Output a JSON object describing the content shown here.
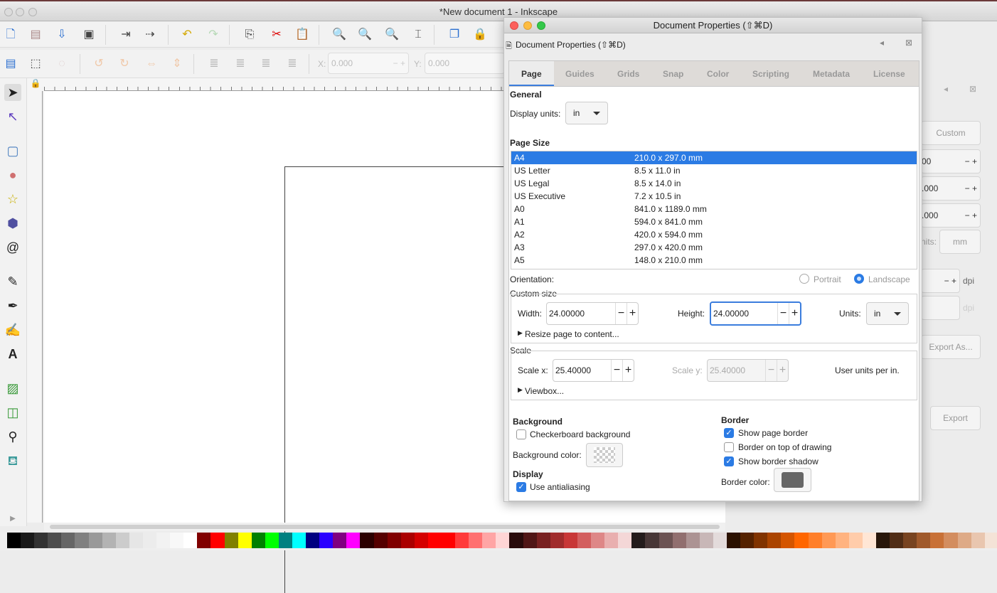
{
  "window": {
    "title": "*New document 1 - Inkscape"
  },
  "toolbar": {
    "x_label": "X:",
    "x_value": "0.000",
    "y_label": "Y:",
    "y_value": "0.000"
  },
  "dock": {
    "custom": "Custom",
    "v1": "00",
    "v2": ".000",
    "v3": ".000",
    "units_label": "nits:",
    "units": "mm",
    "dpi1": "dpi",
    "dpi2": "dpi",
    "export_as": "Export As...",
    "export": "Export"
  },
  "dialog": {
    "window_title": "Document Properties (⇧⌘D)",
    "panel_title": "Document Properties (⇧⌘D)",
    "tabs": [
      "Page",
      "Guides",
      "Grids",
      "Snap",
      "Color",
      "Scripting",
      "Metadata",
      "License"
    ],
    "general": {
      "heading": "General",
      "display_units_label": "Display units:",
      "display_units": "in"
    },
    "page_size": {
      "heading": "Page Size",
      "rows": [
        {
          "name": "A4",
          "size": "210.0 x 297.0 mm",
          "selected": true
        },
        {
          "name": "US Letter",
          "size": "8.5 x 11.0 in"
        },
        {
          "name": "US Legal",
          "size": "8.5 x 14.0 in"
        },
        {
          "name": "US Executive",
          "size": "7.2 x 10.5 in"
        },
        {
          "name": "A0",
          "size": "841.0 x 1189.0 mm"
        },
        {
          "name": "A1",
          "size": "594.0 x 841.0 mm"
        },
        {
          "name": "A2",
          "size": "420.0 x 594.0 mm"
        },
        {
          "name": "A3",
          "size": "297.0 x 420.0 mm"
        },
        {
          "name": "A5",
          "size": "148.0 x 210.0 mm"
        }
      ]
    },
    "orientation": {
      "label": "Orientation:",
      "portrait": "Portrait",
      "landscape": "Landscape",
      "selected": "Landscape"
    },
    "custom_size": {
      "heading": "Custom size",
      "width_label": "Width:",
      "width": "24.00000",
      "height_label": "Height:",
      "height": "24.00000",
      "units_label": "Units:",
      "units": "in",
      "resize": "Resize page to content..."
    },
    "scale": {
      "heading": "Scale",
      "scale_x_label": "Scale x:",
      "scale_x": "25.40000",
      "scale_y_label": "Scale y:",
      "scale_y": "25.40000",
      "user_units": "User units per in.",
      "viewbox": "Viewbox..."
    },
    "background": {
      "heading": "Background",
      "checkerboard": "Checkerboard background",
      "checkerboard_checked": false,
      "color_label": "Background color:"
    },
    "display": {
      "heading": "Display",
      "antialiasing": "Use antialiasing",
      "antialiasing_checked": true
    },
    "border": {
      "heading": "Border",
      "show_border": "Show page border",
      "show_border_checked": true,
      "on_top": "Border on top of drawing",
      "on_top_checked": false,
      "shadow": "Show border shadow",
      "shadow_checked": true,
      "color_label": "Border color:",
      "color": "#666666"
    }
  },
  "palette": [
    "#000000",
    "#1a1a1a",
    "#333333",
    "#4d4d4d",
    "#666666",
    "#808080",
    "#999999",
    "#b3b3b3",
    "#cccccc",
    "#e6e6e6",
    "#ececec",
    "#f2f2f2",
    "#f8f8f8",
    "#ffffff",
    "#800000",
    "#ff0000",
    "#808000",
    "#ffff00",
    "#008000",
    "#00ff00",
    "#008080",
    "#00ffff",
    "#000080",
    "#2a00ff",
    "#800080",
    "#ff00ff",
    "#2b0000",
    "#550000",
    "#800000",
    "#aa0000",
    "#d40000",
    "#ff0000",
    "#ff0000",
    "#ff3a3a",
    "#ff7070",
    "#ffa5a5",
    "#ffd5d5",
    "#280b0b",
    "#501616",
    "#782121",
    "#a02c2c",
    "#c83737",
    "#d35f5f",
    "#de8787",
    "#e9afaf",
    "#f4d7d7",
    "#241c1c",
    "#483737",
    "#6c5353",
    "#916f6f",
    "#ac9393",
    "#c8b7b7",
    "#e3dbdb",
    "#2b1100",
    "#552200",
    "#803300",
    "#aa4400",
    "#d45500",
    "#ff6600",
    "#ff7f2a",
    "#ff9955",
    "#ffb380",
    "#ffccaa",
    "#ffe6d5",
    "#28170b",
    "#502d16",
    "#784421",
    "#a05a2c",
    "#c87137",
    "#d38d5f",
    "#deaa87",
    "#e9c6af",
    "#f4e3d7"
  ]
}
